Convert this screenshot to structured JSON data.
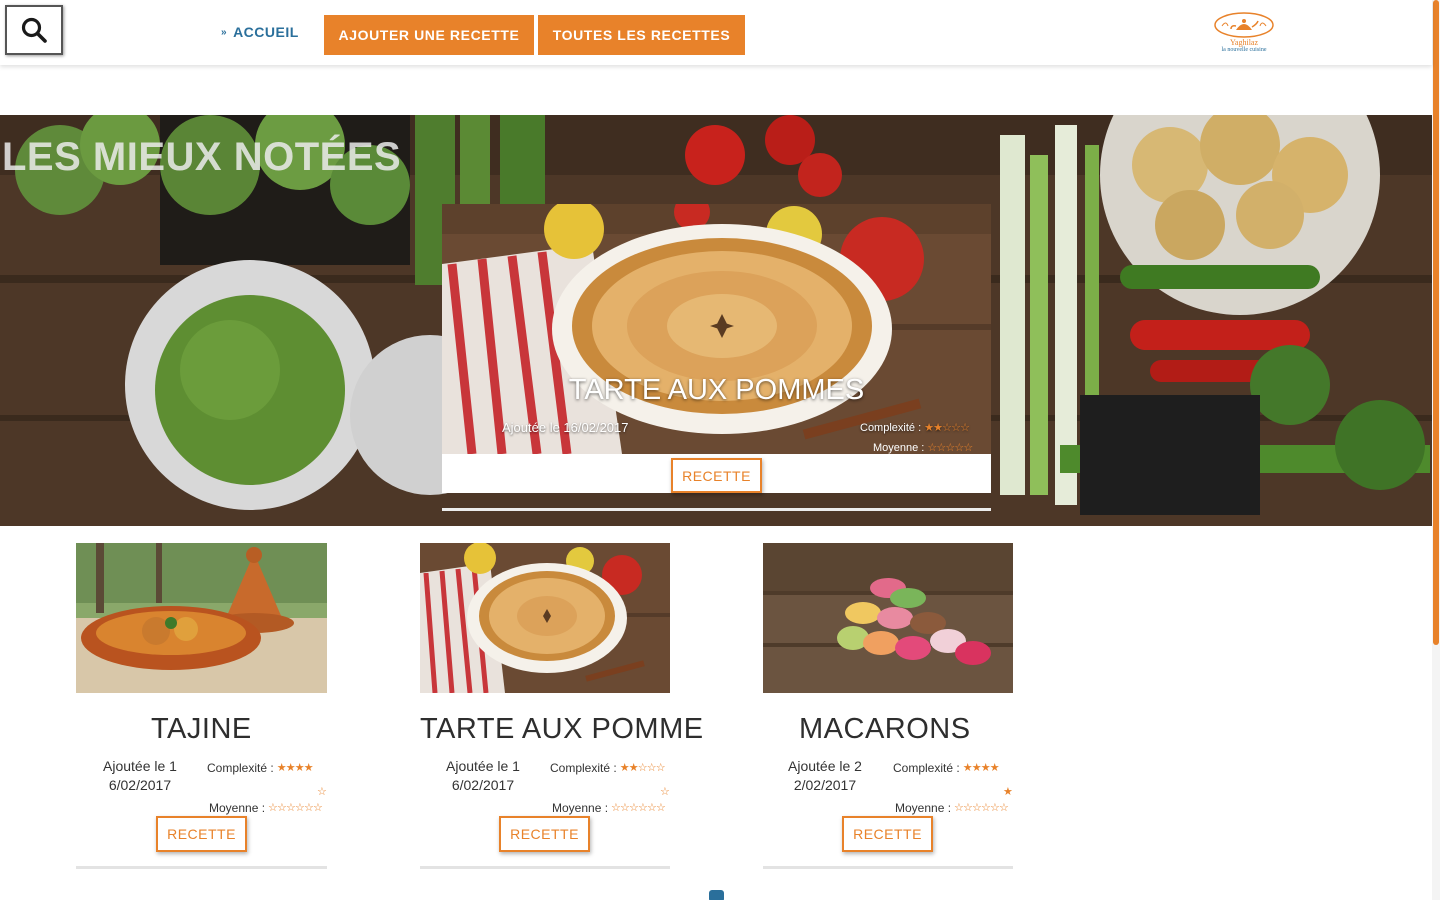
{
  "header": {
    "home_label": "ACCUEIL",
    "add_label": "AJOUTER UNE RECETTE",
    "all_label": "TOUTES LES RECETTES",
    "logo_name": "Yaghilaz",
    "logo_tagline": "la nouvelle cuisine"
  },
  "hero": {
    "title": "LES MIEUX NOTÉES",
    "featured": {
      "title": "TARTE AUX POMMES",
      "date": "Ajoutée le 16/02/2017",
      "complexity_label": "Complexité :",
      "complexity": 2,
      "average_label": "Moyenne :",
      "average": 0,
      "button": "RECETTE"
    }
  },
  "cards": [
    {
      "title": "TAJINE",
      "date_line1": "Ajoutée le 1",
      "date_line2": "6/02/2017",
      "complexity_label": "Complexité :",
      "complexity": 4,
      "extra_star": "empty",
      "average_label": "Moyenne :",
      "average": 0,
      "button": "RECETTE"
    },
    {
      "title": "TARTE AUX POMME",
      "date_line1": "Ajoutée le 1",
      "date_line2": "6/02/2017",
      "complexity_label": "Complexité :",
      "complexity": 2,
      "extra_star": "empty",
      "average_label": "Moyenne :",
      "average": 0,
      "button": "RECETTE"
    },
    {
      "title": "MACARONS",
      "date_line1": "Ajoutée le 2",
      "date_line2": "2/02/2017",
      "complexity_label": "Complexité :",
      "complexity": 4,
      "extra_star": "full",
      "average_label": "Moyenne :",
      "average": 0,
      "button": "RECETTE"
    }
  ],
  "colors": {
    "accent": "#e8822a",
    "link": "#2a6f9b"
  },
  "icons": {
    "search": "search-icon",
    "home_chevron": "chevron-double-down-icon",
    "star_full": "star-filled-icon",
    "star_empty": "star-outline-icon"
  }
}
